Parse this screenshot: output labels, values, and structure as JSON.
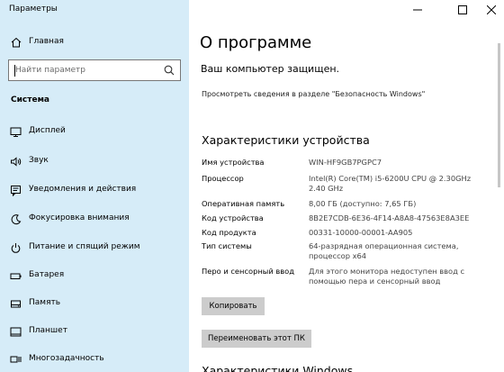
{
  "window": {
    "title": "Параметры",
    "minimize_icon": "minimize-icon",
    "maximize_icon": "maximize-icon",
    "close_icon": "close-icon"
  },
  "sidebar": {
    "home_label": "Главная",
    "search_placeholder": "Найти параметр",
    "section_title": "Система",
    "items": [
      {
        "label": "Дисплей",
        "icon": "display-icon"
      },
      {
        "label": "Звук",
        "icon": "sound-icon"
      },
      {
        "label": "Уведомления и действия",
        "icon": "notifications-icon"
      },
      {
        "label": "Фокусировка внимания",
        "icon": "focus-assist-icon"
      },
      {
        "label": "Питание и спящий режим",
        "icon": "power-icon"
      },
      {
        "label": "Батарея",
        "icon": "battery-icon"
      },
      {
        "label": "Память",
        "icon": "storage-icon"
      },
      {
        "label": "Планшет",
        "icon": "tablet-icon"
      },
      {
        "label": "Многозадачность",
        "icon": "multitasking-icon"
      }
    ]
  },
  "main": {
    "title": "О программе",
    "protection_status": "Ваш компьютер защищен.",
    "details_link": "Просмотреть сведения в разделе \"Безопасность Windows\"",
    "specs_title": "Характеристики устройства",
    "specs": [
      {
        "key": "Имя устройства",
        "value": "WIN-HF9GB7PGPC7"
      },
      {
        "key": "Процессор",
        "value": "Intel(R) Core(TM) i5-6200U CPU @ 2.30GHz   2.40 GHz"
      },
      {
        "key": "Оперативная память",
        "value": "8,00 ГБ (доступно: 7,65 ГБ)"
      },
      {
        "key": "Код устройства",
        "value": "8B2E7CDB-6E36-4F14-A8A8-47563E8A3EE"
      },
      {
        "key": "Код продукта",
        "value": "00331-10000-00001-AA905"
      },
      {
        "key": "Тип системы",
        "value": "64-разрядная операционная система, процессор x64"
      },
      {
        "key": "Перо и сенсорный ввод",
        "value": "Для этого монитора недоступен ввод с помощью пера и сенсорный ввод"
      }
    ],
    "copy_button": "Копировать",
    "rename_button": "Переименовать этот ПК",
    "windows_specs_title": "Характеристики Windows"
  }
}
